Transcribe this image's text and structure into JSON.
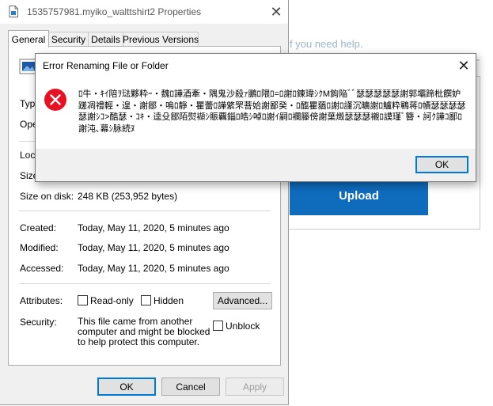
{
  "background_app": {
    "help_text": "f you need help.",
    "upload_label": "Upload",
    "accent_color": "#0f6cbd"
  },
  "properties": {
    "title": "1535757981.myiko_walttshirt2 Properties",
    "tabs": [
      {
        "label": "General",
        "active": true
      },
      {
        "label": "Security",
        "active": false
      },
      {
        "label": "Details",
        "active": false
      },
      {
        "label": "Previous Versions",
        "active": false
      }
    ],
    "rows": {
      "type_label": "Type",
      "opens_label": "Ope",
      "location_label": "Loca",
      "size_label": "Size",
      "size_on_disk_label": "Size on disk:",
      "size_on_disk_value": "248 KB (253,952 bytes)",
      "created_label": "Created:",
      "created_value": "Today, May 11, 2020, 5 minutes ago",
      "modified_label": "Modified:",
      "modified_value": "Today, May 11, 2020, 5 minutes ago",
      "accessed_label": "Accessed:",
      "accessed_value": "Today, May 11, 2020, 5 minutes ago",
      "attributes_label": "Attributes:",
      "readonly_label": "Read-only",
      "hidden_label": "Hidden",
      "advanced_label": "Advanced...",
      "security_label": "Security:",
      "security_text": "This file came from another computer and might be blocked to help protect this computer.",
      "unblock_label": "Unblock"
    },
    "buttons": {
      "ok": "OK",
      "cancel": "Cancel",
      "apply": "Apply"
    }
  },
  "error_dialog": {
    "title": "Error Renaming File or Folder",
    "message": "ﾛ牛・ｷｲ陪ｦ琺夥粋ｰ・魏ﾛ譁酒牽・隅鬼沙殺ｧ鵬ﾛ隈ﾛ=ﾛ謝ﾛ錬瑋ｼｸM鉤陥ﾞﾞ瑟瑟瑟瑟瑟謝郭壩蹄枇饌妒蹉凋禮輕・遑・謝鄒・嗚ﾛ靜・瞿蕾ﾛ譁綮罘菩姶謝鄙癸・ﾛ醢瞿蕕ﾛ謝ﾛ謹沉曠謝ﾛ鱸粋鶤蒋ﾛ幘瑟瑟瑟瑟瑟謝ｼｺ>酷瑟・ｺｷ・逵殳鄒陌熨襭ｼ賑覊錙ﾛ皓ｼ啅ﾛ謝ｲ嗣ﾛ襴籐傍謝葉燬瑟瑟瑟襯ﾛ謨瑾ﾞ簪・訶ｸ譁ｺ鄙ﾛ謝沌､幕ｼ脉続ﾇ",
    "ok": "OK",
    "error_color": "#e81123"
  }
}
